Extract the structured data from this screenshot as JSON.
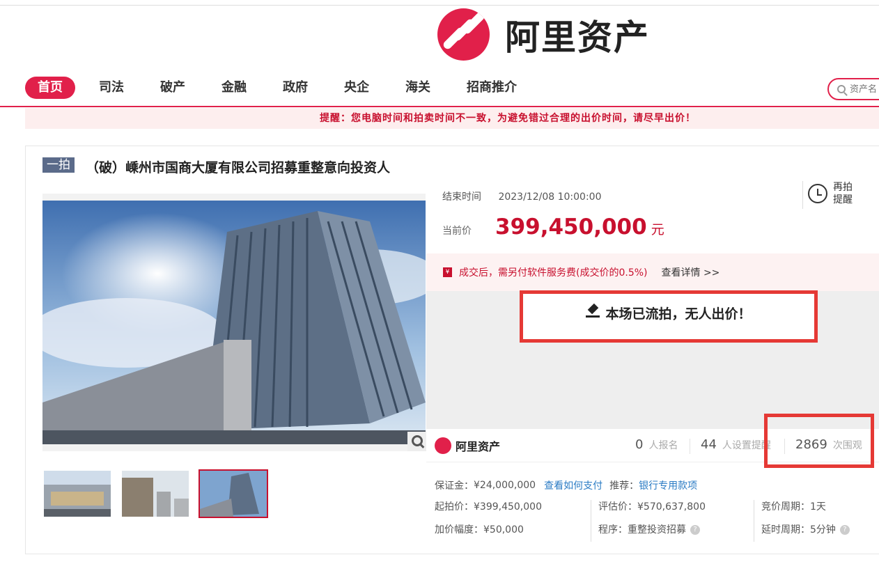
{
  "brand": {
    "name": "阿里资产",
    "color": "#e1204a"
  },
  "nav": {
    "items": [
      "首页",
      "司法",
      "破产",
      "金融",
      "政府",
      "央企",
      "海关",
      "招商推介"
    ],
    "search_placeholder": "资产名"
  },
  "reminder": "提醒：您电脑时间和拍卖时间不一致，为避免错过合理的出价时间，请尽早出价！",
  "auction": {
    "badge": "一拍",
    "title": "（破）嵊州市国商大厦有限公司招募重整意向投资人",
    "end_label": "结束时间",
    "end_time": "2023/12/08 10:00:00",
    "price_label": "当前价",
    "price": "399,450,000",
    "unit": "元",
    "remind_label": "再拍提醒",
    "fee_icon": "¥",
    "fee_text": "成交后，需另付软件服务费(成交价的0.5%)",
    "fee_link": "查看详情 >>",
    "status": "本场已流拍，无人出价！",
    "stats": {
      "signups": "0",
      "signups_label": "人报名",
      "reminders": "44",
      "reminders_label": "人设置提醒",
      "views": "2869",
      "views_label": "次围观"
    },
    "deposit_label": "保证金：",
    "deposit": "¥24,000,000",
    "deposit_link": "查看如何支付",
    "recommend_label": "推荐：",
    "recommend": "银行专用款项",
    "start_price": "起拍价：¥399,450,000",
    "increment": "加价幅度：¥50,000",
    "appraisal": "评估价：¥570,637,800",
    "procedure_label": "程序：",
    "procedure": "重整投资招募",
    "cycle": "竞价周期：1天",
    "delay": "延时周期：5分钟"
  },
  "status_color": "#e53935",
  "price_color": "#c8102e"
}
